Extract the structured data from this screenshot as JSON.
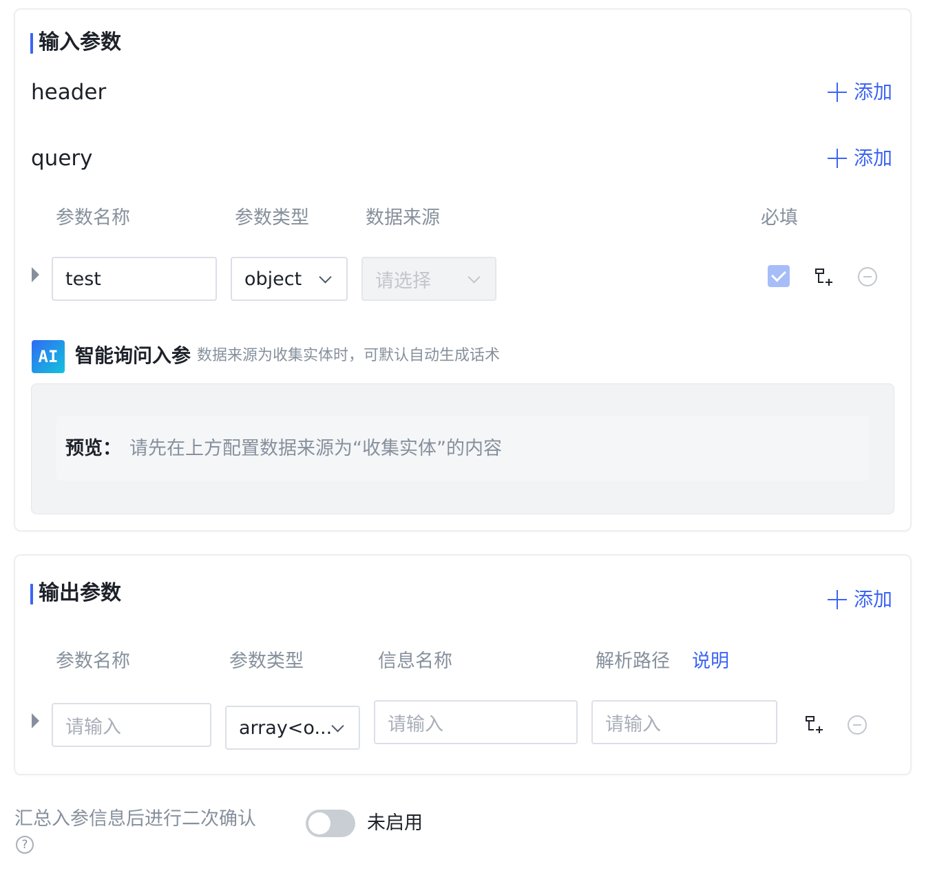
{
  "input_section": {
    "title": "输入参数",
    "header_label": "header",
    "query_label": "query",
    "add_label": "添加",
    "columns": {
      "name": "参数名称",
      "type": "参数类型",
      "source": "数据来源",
      "required": "必填"
    },
    "row": {
      "name_value": "test",
      "type_value": "object",
      "source_placeholder": "请选择",
      "required": true
    },
    "ai": {
      "badge": "AI",
      "title": "智能询问入参",
      "hint": "数据来源为收集实体时，可默认自动生成话术",
      "preview_label": "预览：",
      "preview_text": "请先在上方配置数据来源为“收集实体”的内容"
    }
  },
  "output_section": {
    "title": "输出参数",
    "add_label": "添加",
    "columns": {
      "name": "参数名称",
      "type": "参数类型",
      "info": "信息名称",
      "path": "解析路径",
      "path_help": "说明"
    },
    "row": {
      "name_placeholder": "请输入",
      "type_value": "array<o...",
      "info_placeholder": "请输入",
      "path_placeholder": "请输入"
    }
  },
  "confirm": {
    "label": "汇总入参信息后进行二次确认",
    "help_icon": "?",
    "toggle_enabled": false,
    "status_text": "未启用"
  },
  "colors": {
    "accent": "#3b64f4",
    "muted_text": "#86909c",
    "border": "#dcdfe6"
  }
}
